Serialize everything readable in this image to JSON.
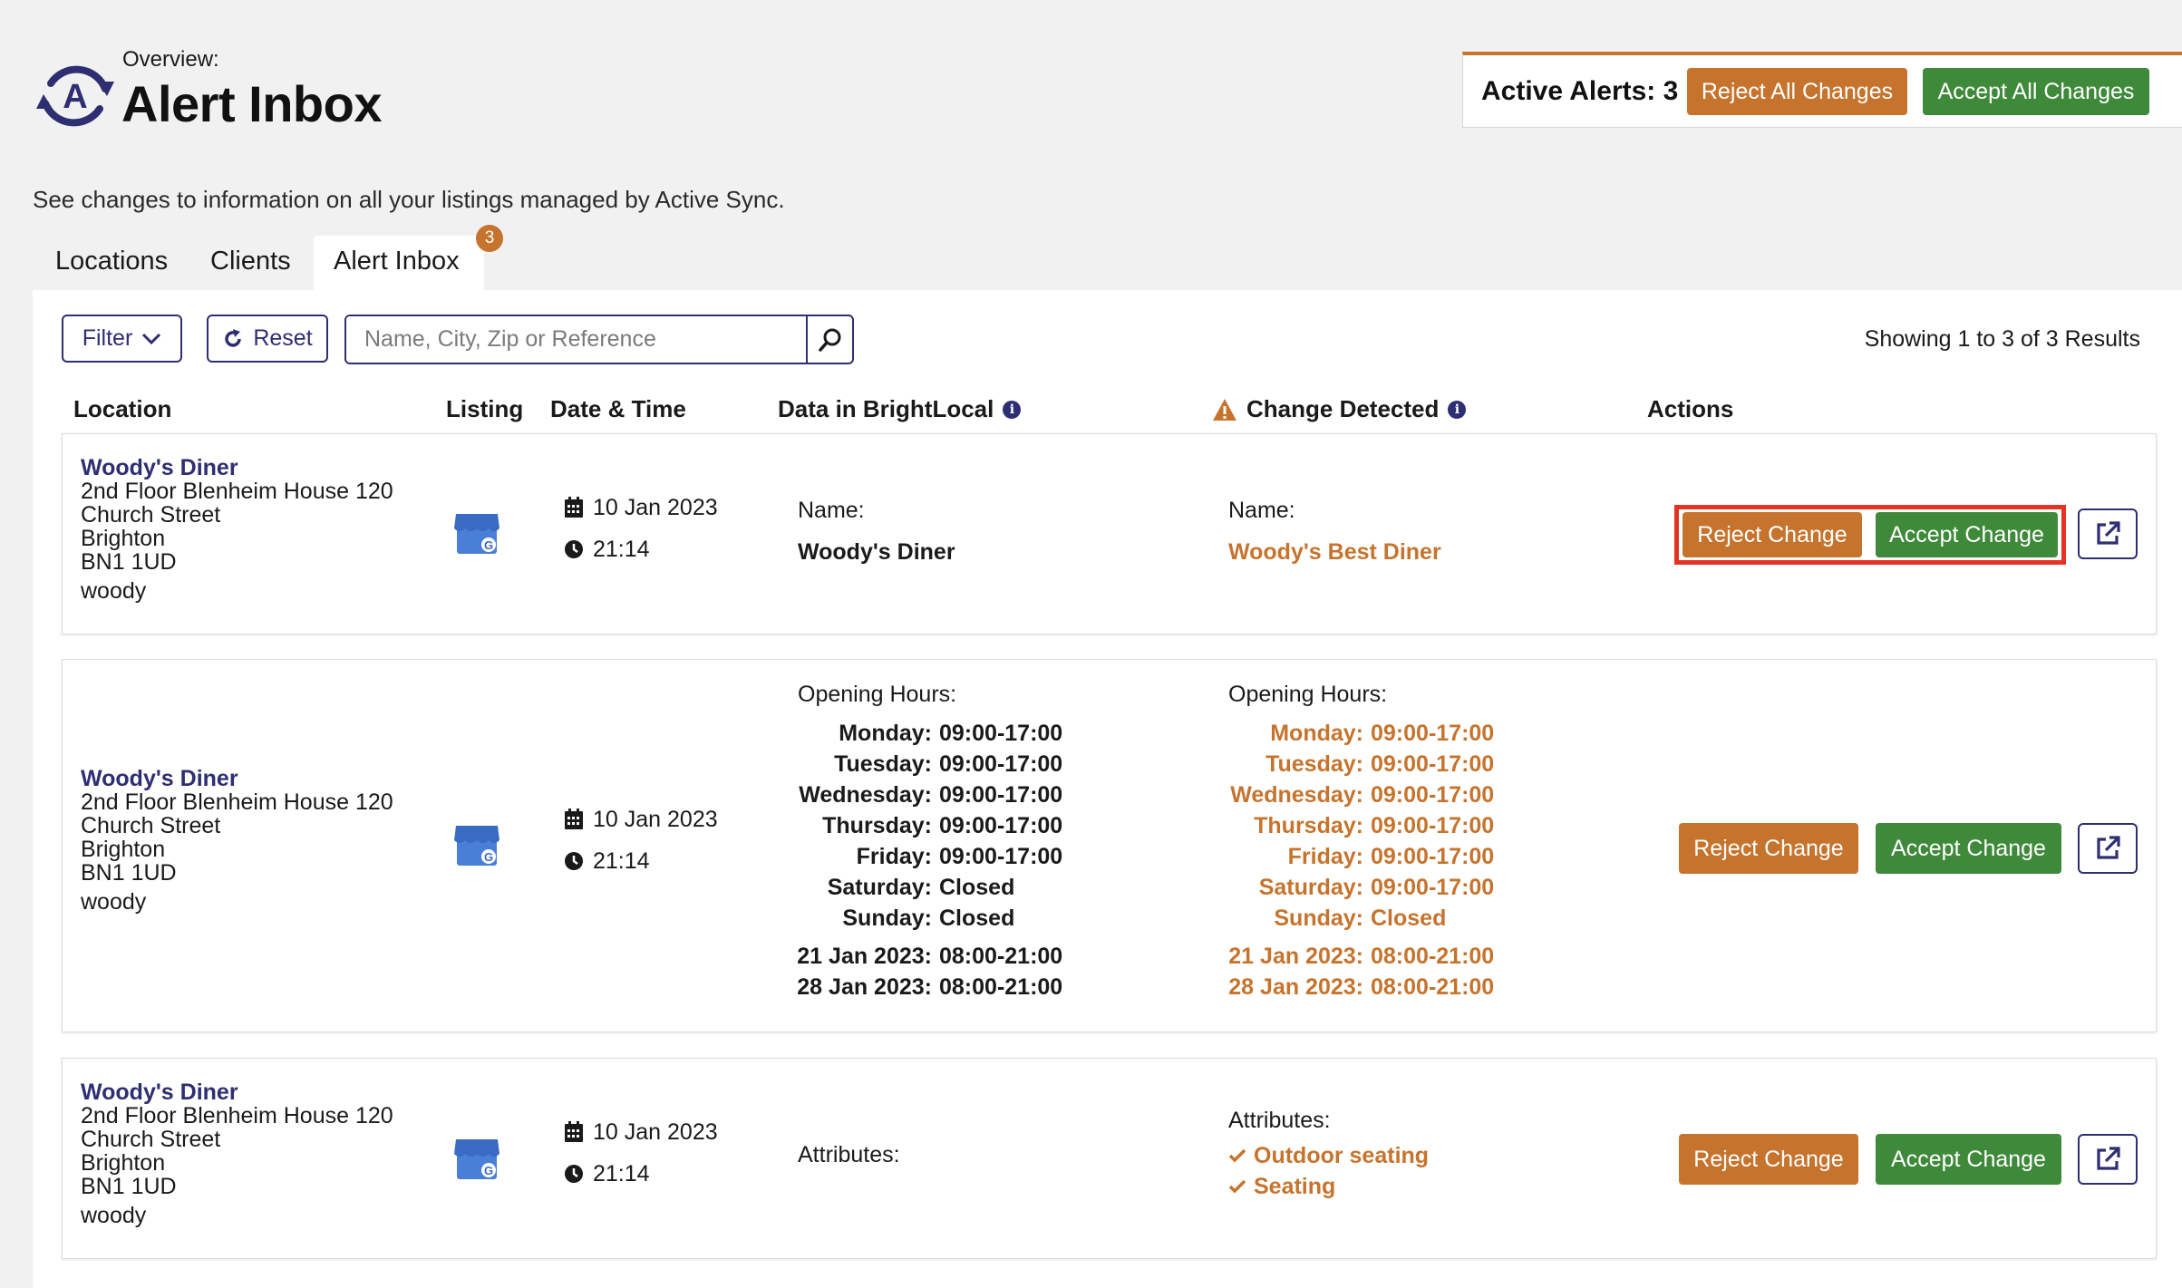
{
  "header": {
    "overview_label": "Overview:",
    "title": "Alert Inbox",
    "logo_icon": "active-sync-logo-icon",
    "active_alerts_label": "Active Alerts: 3",
    "reject_all_label": "Reject All Changes",
    "accept_all_label": "Accept All Changes"
  },
  "subtitle": "See changes to information on all your listings managed by Active Sync.",
  "tabs": [
    {
      "label": "Locations",
      "active": false
    },
    {
      "label": "Clients",
      "active": false
    },
    {
      "label": "Alert Inbox",
      "active": true,
      "badge": "3"
    }
  ],
  "toolbar": {
    "filter_label": "Filter",
    "reset_label": "Reset",
    "search_placeholder": "Name, City, Zip or Reference",
    "search_value": "",
    "results_text": "Showing 1 to 3 of 3 Results"
  },
  "columns": {
    "location": "Location",
    "listing": "Listing",
    "date_time": "Date & Time",
    "data_in_brightlocal": "Data in BrightLocal",
    "change_detected": "Change Detected",
    "actions": "Actions"
  },
  "rows": [
    {
      "location": {
        "name": "Woody's Diner",
        "address1": "2nd Floor Blenheim House 120",
        "address2": "Church Street",
        "city": "Brighton",
        "postcode": "BN1 1UD",
        "reference": "woody"
      },
      "listing_icon": "google-business-store-icon",
      "date": "10 Jan 2023",
      "time": "21:14",
      "current": {
        "label": "Name:",
        "value": "Woody's Diner"
      },
      "detected": {
        "label": "Name:",
        "value": "Woody's Best Diner"
      },
      "reject_label": "Reject Change",
      "accept_label": "Accept Change"
    },
    {
      "location": {
        "name": "Woody's Diner",
        "address1": "2nd Floor Blenheim House 120",
        "address2": "Church Street",
        "city": "Brighton",
        "postcode": "BN1 1UD",
        "reference": "woody"
      },
      "listing_icon": "google-business-store-icon",
      "date": "10 Jan 2023",
      "time": "21:14",
      "current": {
        "label": "Opening Hours:",
        "hours": [
          {
            "day": "Monday:",
            "time": "09:00-17:00"
          },
          {
            "day": "Tuesday:",
            "time": "09:00-17:00"
          },
          {
            "day": "Wednesday:",
            "time": "09:00-17:00"
          },
          {
            "day": "Thursday:",
            "time": "09:00-17:00"
          },
          {
            "day": "Friday:",
            "time": "09:00-17:00"
          },
          {
            "day": "Saturday:",
            "time": "Closed"
          },
          {
            "day": "Sunday:",
            "time": "Closed"
          }
        ],
        "special": [
          {
            "day": "21 Jan 2023:",
            "time": "08:00-21:00"
          },
          {
            "day": "28 Jan 2023:",
            "time": "08:00-21:00"
          }
        ]
      },
      "detected": {
        "label": "Opening Hours:",
        "hours": [
          {
            "day": "Monday:",
            "time": "09:00-17:00"
          },
          {
            "day": "Tuesday:",
            "time": "09:00-17:00"
          },
          {
            "day": "Wednesday:",
            "time": "09:00-17:00"
          },
          {
            "day": "Thursday:",
            "time": "09:00-17:00"
          },
          {
            "day": "Friday:",
            "time": "09:00-17:00"
          },
          {
            "day": "Saturday:",
            "time": "09:00-17:00"
          },
          {
            "day": "Sunday:",
            "time": "Closed"
          }
        ],
        "special": [
          {
            "day": "21 Jan 2023:",
            "time": "08:00-21:00"
          },
          {
            "day": "28 Jan 2023:",
            "time": "08:00-21:00"
          }
        ]
      },
      "reject_label": "Reject Change",
      "accept_label": "Accept Change"
    },
    {
      "location": {
        "name": "Woody's Diner",
        "address1": "2nd Floor Blenheim House 120",
        "address2": "Church Street",
        "city": "Brighton",
        "postcode": "BN1 1UD",
        "reference": "woody"
      },
      "listing_icon": "google-business-store-icon",
      "date": "10 Jan 2023",
      "time": "21:14",
      "current": {
        "label": "Attributes:"
      },
      "detected": {
        "label": "Attributes:",
        "items": [
          "Outdoor seating",
          "Seating"
        ]
      },
      "reject_label": "Reject Change",
      "accept_label": "Accept Change"
    }
  ],
  "colors": {
    "brand_navy": "#2e2e72",
    "reject_orange": "#c6742d",
    "accept_green": "#3f8a3a",
    "highlight_red": "#e53323"
  }
}
